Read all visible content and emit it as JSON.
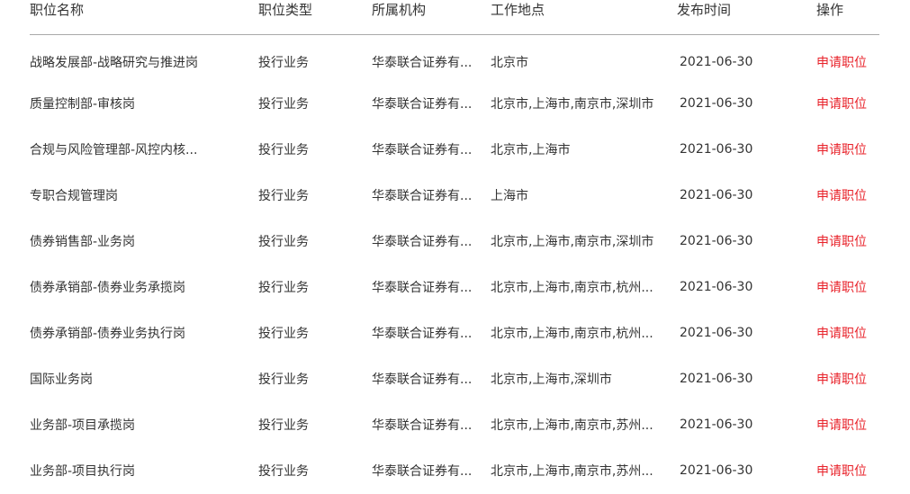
{
  "table": {
    "columns": [
      {
        "key": "title",
        "label": "职位名称"
      },
      {
        "key": "type",
        "label": "职位类型"
      },
      {
        "key": "org",
        "label": "所属机构"
      },
      {
        "key": "loc",
        "label": "工作地点"
      },
      {
        "key": "date",
        "label": "发布时间"
      },
      {
        "key": "action",
        "label": "操作"
      }
    ],
    "accent_color": "#e8222a",
    "divider_color": "#a9a9a9",
    "text_color": "#333333",
    "background_color": "#ffffff",
    "apply_label": "申请职位",
    "rows": [
      {
        "title": "战略发展部-战略研究与推进岗",
        "type": "投行业务",
        "org": "华泰联合证券有...",
        "loc": "北京市",
        "date": "2021-06-30",
        "action": "申请职位"
      },
      {
        "title": "质量控制部-审核岗",
        "type": "投行业务",
        "org": "华泰联合证券有...",
        "loc": "北京市,上海市,南京市,深圳市",
        "date": "2021-06-30",
        "action": "申请职位"
      },
      {
        "title": "合规与风险管理部-风控内核...",
        "type": "投行业务",
        "org": "华泰联合证券有...",
        "loc": "北京市,上海市",
        "date": "2021-06-30",
        "action": "申请职位"
      },
      {
        "title": "专职合规管理岗",
        "type": "投行业务",
        "org": "华泰联合证券有...",
        "loc": "上海市",
        "date": "2021-06-30",
        "action": "申请职位"
      },
      {
        "title": "债券销售部-业务岗",
        "type": "投行业务",
        "org": "华泰联合证券有...",
        "loc": "北京市,上海市,南京市,深圳市",
        "date": "2021-06-30",
        "action": "申请职位"
      },
      {
        "title": "债券承销部-债券业务承揽岗",
        "type": "投行业务",
        "org": "华泰联合证券有...",
        "loc": "北京市,上海市,南京市,杭州...",
        "date": "2021-06-30",
        "action": "申请职位"
      },
      {
        "title": "债券承销部-债券业务执行岗",
        "type": "投行业务",
        "org": "华泰联合证券有...",
        "loc": "北京市,上海市,南京市,杭州...",
        "date": "2021-06-30",
        "action": "申请职位"
      },
      {
        "title": "国际业务岗",
        "type": "投行业务",
        "org": "华泰联合证券有...",
        "loc": "北京市,上海市,深圳市",
        "date": "2021-06-30",
        "action": "申请职位"
      },
      {
        "title": "业务部-项目承揽岗",
        "type": "投行业务",
        "org": "华泰联合证券有...",
        "loc": "北京市,上海市,南京市,苏州...",
        "date": "2021-06-30",
        "action": "申请职位"
      },
      {
        "title": "业务部-项目执行岗",
        "type": "投行业务",
        "org": "华泰联合证券有...",
        "loc": "北京市,上海市,南京市,苏州...",
        "date": "2021-06-30",
        "action": "申请职位"
      }
    ]
  }
}
